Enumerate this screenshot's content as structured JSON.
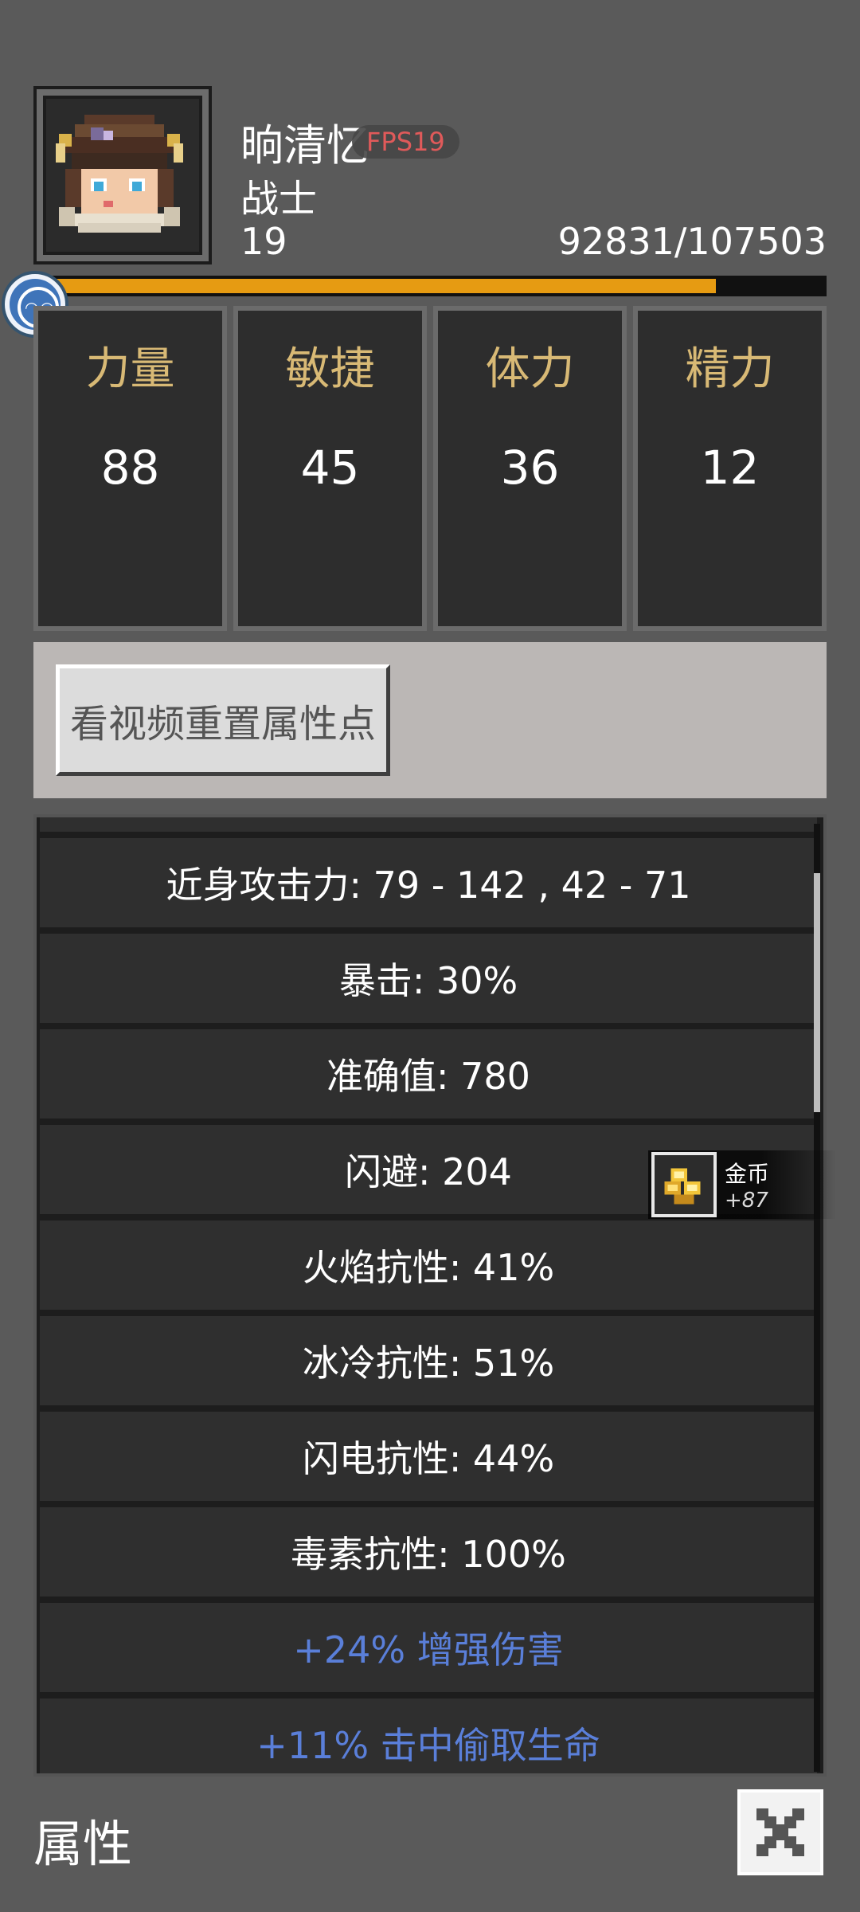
{
  "character": {
    "name": "晌清忆",
    "fps_badge": "FPS19",
    "class": "战士",
    "level": "19",
    "exp_text": "92831/107503",
    "exp_progress": 0.8635
  },
  "stats": [
    {
      "label": "力量",
      "value": "88"
    },
    {
      "label": "敏捷",
      "value": "45"
    },
    {
      "label": "体力",
      "value": "36"
    },
    {
      "label": "精力",
      "value": "12"
    }
  ],
  "reset_button": {
    "label": "看视频重置属性点"
  },
  "attributes": [
    {
      "text": "近身攻击力: 79 - 142 , 42 - 71",
      "bonus": false
    },
    {
      "text": "暴击: 30%",
      "bonus": false
    },
    {
      "text": "准确值: 780",
      "bonus": false
    },
    {
      "text": "闪避: 204",
      "bonus": false
    },
    {
      "text": "火焰抗性: 41%",
      "bonus": false
    },
    {
      "text": "冰冷抗性: 51%",
      "bonus": false
    },
    {
      "text": "闪电抗性: 44%",
      "bonus": false
    },
    {
      "text": "毒素抗性: 100%",
      "bonus": false
    },
    {
      "text": "+24% 增强伤害",
      "bonus": true
    },
    {
      "text": "+11% 击中偷取生命",
      "bonus": true
    }
  ],
  "toast": {
    "title": "金币",
    "amount": "+87",
    "icon": "gold-coins-icon"
  },
  "footer": {
    "title": "属性",
    "close_icon": "close-x-icon"
  },
  "colors": {
    "background": "#5a5a5a",
    "stat_label": "#d8b975",
    "bonus_text": "#5a7fd9",
    "exp_bar": "#e69b12",
    "fps_text": "#e05a5a"
  }
}
